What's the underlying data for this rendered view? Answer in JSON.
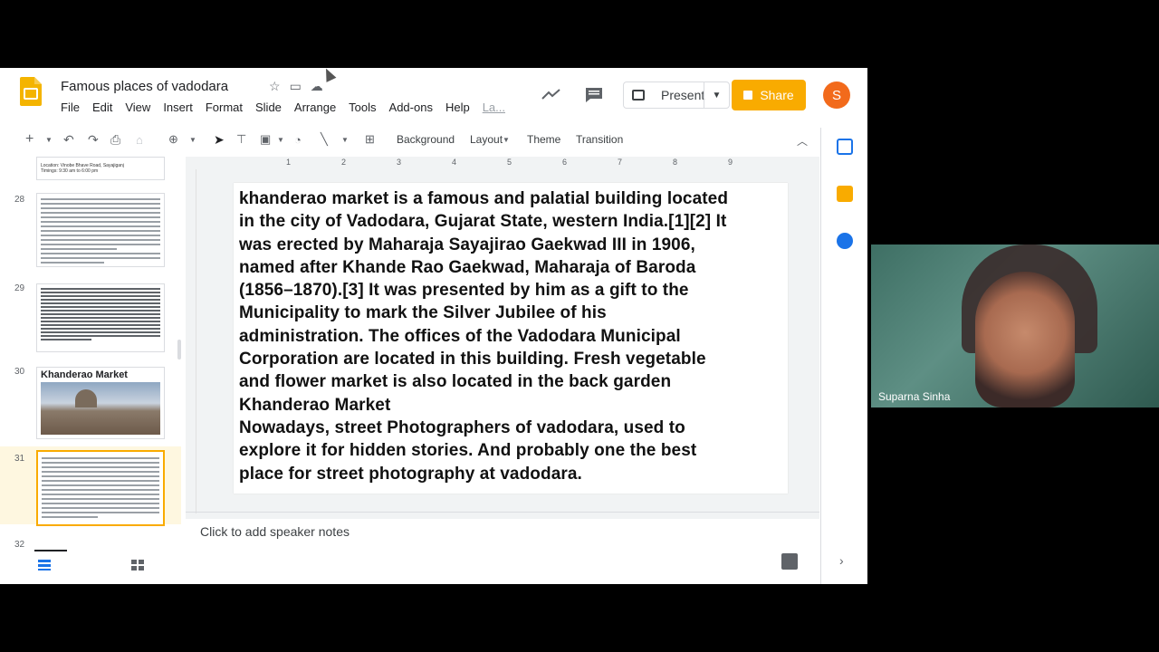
{
  "doc": {
    "title": "Famous places of vadodara",
    "menu": [
      "File",
      "Edit",
      "View",
      "Insert",
      "Format",
      "Slide",
      "Arrange",
      "Tools",
      "Add-ons",
      "Help",
      "La..."
    ]
  },
  "header": {
    "present_label": "Present",
    "share_label": "Share",
    "avatar_initial": "S"
  },
  "toolbar": {
    "background_label": "Background",
    "layout_label": "Layout",
    "theme_label": "Theme",
    "transition_label": "Transition"
  },
  "ruler": [
    "1",
    "2",
    "3",
    "4",
    "5",
    "6",
    "7",
    "8",
    "9"
  ],
  "filmstrip": {
    "slide_numbers": [
      "28",
      "29",
      "30",
      "31",
      "32"
    ],
    "slide30_title": "Khanderao Market",
    "slide27_caption": "Location: Vinobe Bhave Road, Sayajiganj",
    "slide27_caption2": "Timings: 9:30 am to 6:00 pm"
  },
  "slide": {
    "body_lines": [
      "khanderao market is a famous and palatial building located",
      "in the city of Vadodara, Gujarat State, western India.[1][2] It",
      "was erected by Maharaja Sayajirao Gaekwad III in 1906,",
      "named after Khande Rao Gaekwad, Maharaja of Baroda",
      "(1856–1870).[3] It was presented by him as a gift to the",
      "Municipality to mark the Silver Jubilee of his",
      "administration. The offices of the Vadodara Municipal",
      "Corporation are located in this building. Fresh vegetable",
      "and flower market is also located in the back garden",
      "Khanderao Market",
      "Nowadays, street Photographers of vadodara, used to",
      "explore it for hidden stories. And probably one the best",
      "place for street photography at vadodara."
    ]
  },
  "notes": {
    "placeholder": "Click to add speaker notes"
  },
  "video": {
    "participant_name": "Suparna Sinha"
  },
  "colors": {
    "accent": "#f9ab00",
    "avatar": "#f26a1b",
    "selected_bg": "#fef7e0"
  }
}
